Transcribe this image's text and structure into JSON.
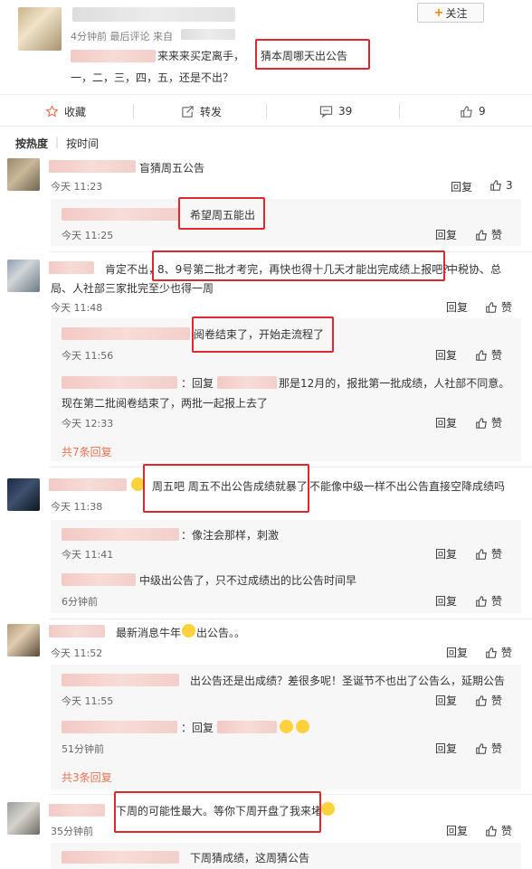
{
  "post": {
    "meta": "4分钟前 最后评论 来自",
    "text_part1": "来来来买定离手，",
    "text_highlight": "猜本周哪天出公告",
    "text_line2": "一，二，三，四，五，还是不出？",
    "follow_label": "关注"
  },
  "actions": {
    "favorite": "收藏",
    "forward": "转发",
    "comments": "39",
    "likes": "9"
  },
  "sort": {
    "hot": "按热度",
    "time": "按时间"
  },
  "reply_label": "回复",
  "like_label": "赞",
  "comments": [
    {
      "text": "盲猜周五公告",
      "time": "今天 11:23",
      "likes": "3",
      "replies": [
        {
          "text": "希望周五能出",
          "time": "今天 11:25"
        }
      ]
    },
    {
      "text_prefix": "肯定不出，",
      "text_highlight": "8、9号第二批才考完，再快也得十几天才能出完成绩上报吧？",
      "text_suffix": "中税协、总",
      "text_line2": "局、人社部三家批完至少也得一周",
      "time": "今天 11:48",
      "replies": [
        {
          "text": "阅卷结束了，开始走流程了",
          "time": "今天 11:56"
        },
        {
          "prefix": "：回复",
          "text": "那是12月的，报批第一批成绩，人社部不同意。",
          "line2": "现在第二批阅卷结束了，两批一起报上去了",
          "time": "今天 12:33"
        }
      ],
      "more": "共7条回复"
    },
    {
      "text_highlight": "周五吧 周五不出公告成绩就暴了",
      "text_suffix": "不能像中级一样不出公告直接空降成绩吗",
      "time": "今天 11:38",
      "replies": [
        {
          "text": "：像注会那样，刺激",
          "time": "今天 11:41"
        },
        {
          "text": "中级出公告了，只不过成绩出的比公告时间早",
          "time": "6分钟前"
        }
      ]
    },
    {
      "text_prefix": "最新消息牛年",
      "text_suffix": "出公告。。",
      "time": "今天 11:52",
      "replies": [
        {
          "text": "出公告还是出成绩？差很多呢！圣诞节不也出了公告么，延期公告",
          "time": "今天 11:55"
        },
        {
          "text": "：回复",
          "time": "51分钟前"
        }
      ],
      "more": "共3条回复"
    },
    {
      "text_highlight": "下周的可能性最大。等你下周开盘了我来堵",
      "time": "35分钟前",
      "replies": [
        {
          "text": "下周猜成绩，这周猜公告"
        }
      ]
    }
  ],
  "colors": {
    "accent": "#eb7350",
    "highlight_box": "#e0262e",
    "follow_plus": "#ff8200"
  }
}
